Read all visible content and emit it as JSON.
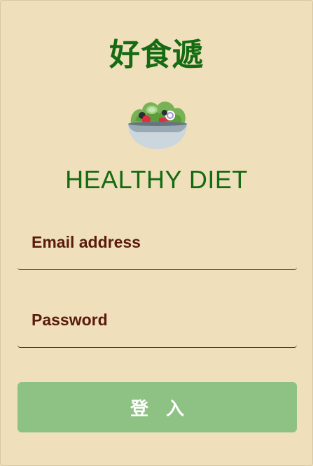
{
  "brand": {
    "title": "好食遞",
    "subtitle": "HEALTHY DIET",
    "logo_icon": "green-salad-icon"
  },
  "form": {
    "email": {
      "label": "Email address",
      "value": ""
    },
    "password": {
      "label": "Password",
      "value": ""
    },
    "submit_label": "登 入"
  },
  "colors": {
    "background": "#efdfbb",
    "brand_green": "#146b12",
    "label_brown": "#5a1a0c",
    "button_green": "#8dc284",
    "button_text": "#ffffff"
  }
}
